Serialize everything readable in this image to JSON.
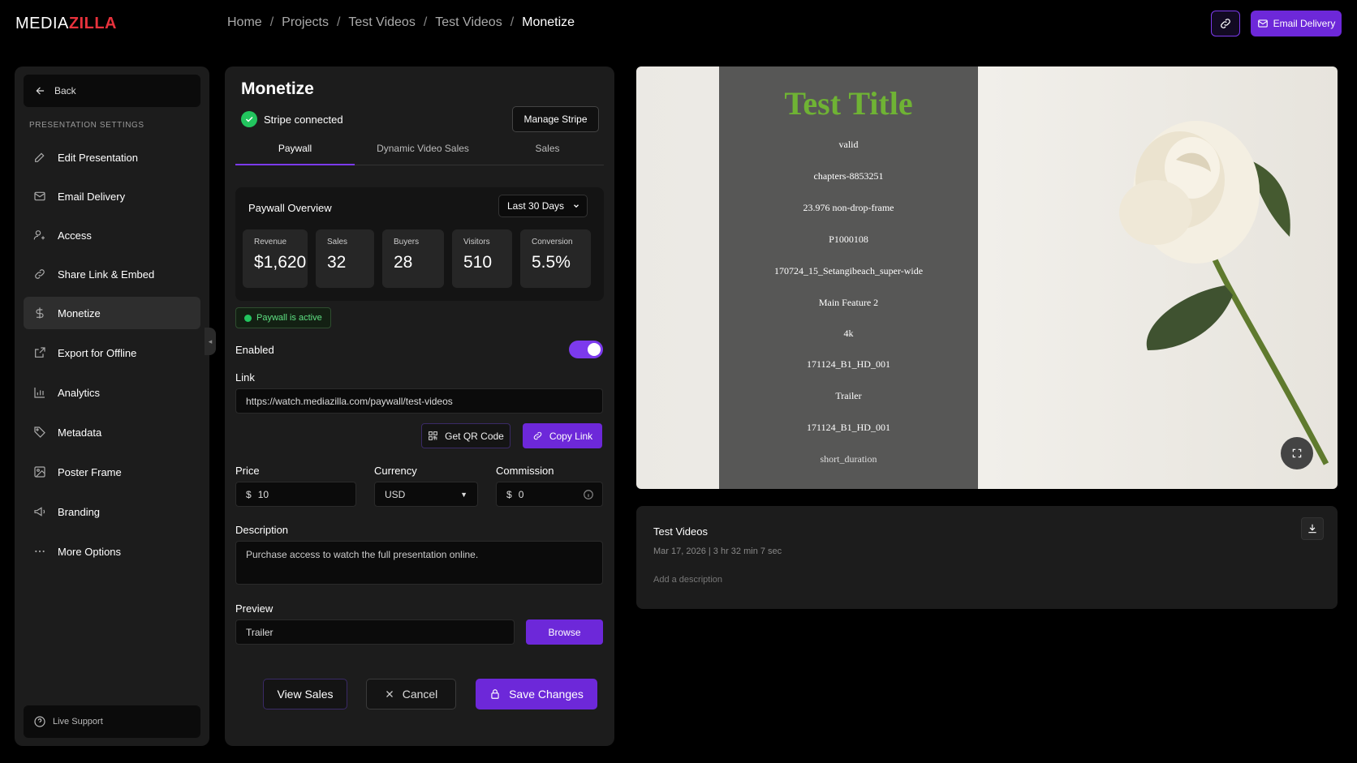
{
  "logo": {
    "part1": "MEDIA",
    "part2": "ZILLA"
  },
  "breadcrumb": [
    "Home",
    "Projects",
    "Test Videos",
    "Test Videos",
    "Monetize"
  ],
  "topbar": {
    "email_delivery": "Email Delivery"
  },
  "sidebar": {
    "back": "Back",
    "heading": "PRESENTATION SETTINGS",
    "items": [
      {
        "label": "Edit Presentation",
        "icon": "pencil-icon"
      },
      {
        "label": "Email Delivery",
        "icon": "mail-icon"
      },
      {
        "label": "Access",
        "icon": "user-key-icon"
      },
      {
        "label": "Share Link & Embed",
        "icon": "link-icon"
      },
      {
        "label": "Monetize",
        "icon": "dollar-icon"
      },
      {
        "label": "Export for Offline",
        "icon": "export-icon"
      },
      {
        "label": "Analytics",
        "icon": "bar-chart-icon"
      },
      {
        "label": "Metadata",
        "icon": "tag-icon"
      },
      {
        "label": "Poster Frame",
        "icon": "image-icon"
      },
      {
        "label": "Branding",
        "icon": "megaphone-icon"
      },
      {
        "label": "More Options",
        "icon": "more-icon"
      }
    ],
    "live_support": "Live Support"
  },
  "monetize": {
    "title": "Monetize",
    "stripe_status": "Stripe connected",
    "manage_stripe": "Manage Stripe",
    "tabs": [
      "Paywall",
      "Dynamic Video Sales",
      "Sales"
    ],
    "overview": {
      "title": "Paywall Overview",
      "range": "Last 30 Days",
      "stats": [
        {
          "label": "Revenue",
          "value": "$1,620"
        },
        {
          "label": "Sales",
          "value": "32"
        },
        {
          "label": "Buyers",
          "value": "28"
        },
        {
          "label": "Visitors",
          "value": "510"
        },
        {
          "label": "Conversion",
          "value": "5.5%"
        }
      ]
    },
    "paywall_status": "Paywall is active",
    "enabled_label": "Enabled",
    "link_label": "Link",
    "link_value": "https://watch.mediazilla.com/paywall/test-videos",
    "qr_button": "Get QR Code",
    "copy_button": "Copy Link",
    "price_label": "Price",
    "price_symbol": "$",
    "price_value": "10",
    "currency_label": "Currency",
    "currency_value": "USD",
    "commission_label": "Commission",
    "commission_symbol": "$",
    "commission_value": "0",
    "description_label": "Description",
    "description_value": "Purchase access to watch the full presentation online.",
    "preview_label": "Preview",
    "preview_value": "Trailer",
    "browse_button": "Browse",
    "view_sales": "View Sales",
    "cancel": "Cancel",
    "save": "Save Changes"
  },
  "poster": {
    "title": "Test Title",
    "lines": [
      "valid",
      "chapters-8853251",
      "23.976 non-drop-frame",
      "P1000108",
      "170724_15_Setangibeach_super-wide",
      "Main Feature 2",
      "4k",
      "171124_B1_HD_001",
      "Trailer",
      "171124_B1_HD_001",
      "short_duration"
    ]
  },
  "video_info": {
    "title": "Test Videos",
    "meta": "Mar 17, 2026 | 3 hr 32 min 7 sec",
    "description_placeholder": "Add a description"
  },
  "colors": {
    "accent": "#6d28d9",
    "success": "#22c55e",
    "brand_red": "#e8323c"
  }
}
